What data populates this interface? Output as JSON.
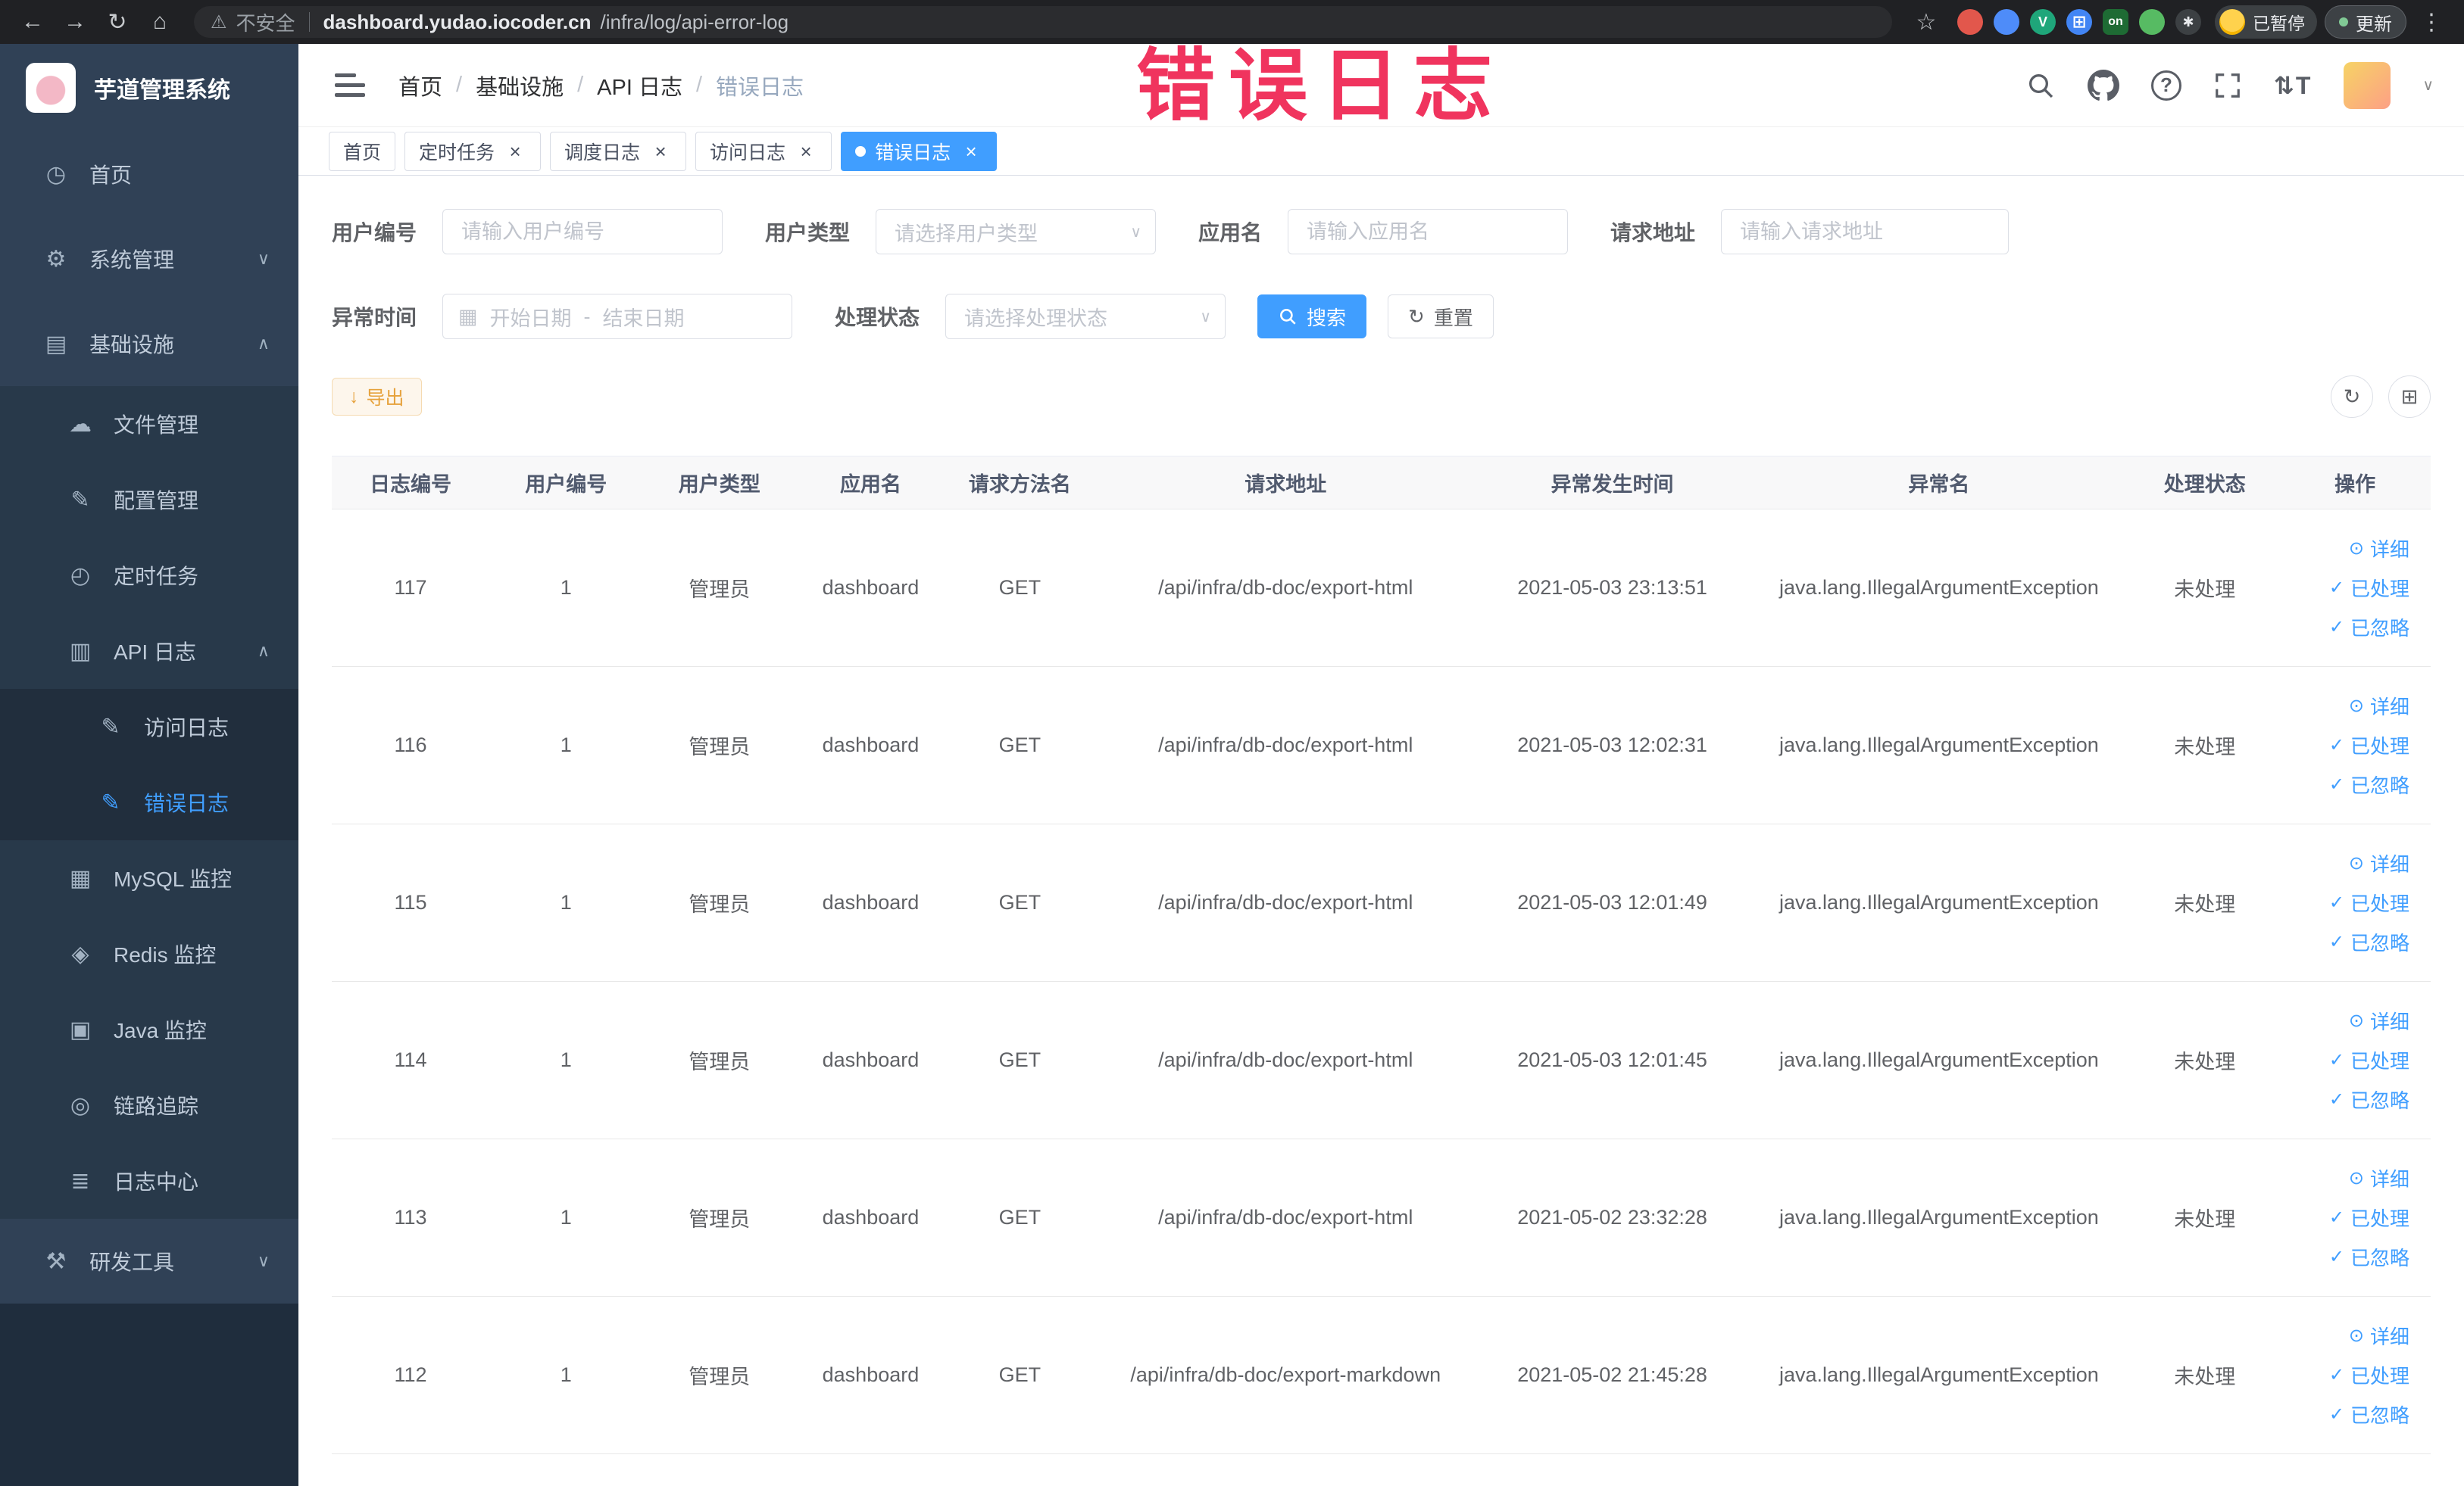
{
  "browser": {
    "security_label": "不安全",
    "url_domain": "dashboard.yudao.iocoder.cn",
    "url_path": "/infra/log/api-error-log",
    "on_badge": "on",
    "paused_badge": "已暂停",
    "update_button": "更新"
  },
  "watermark": "错误日志",
  "sidebar": {
    "logo_title": "芋道管理系统",
    "items": [
      {
        "key": "home",
        "label": "首页",
        "glyph": "◷",
        "icon": "dashboard",
        "level": 0
      },
      {
        "key": "system",
        "label": "系统管理",
        "glyph": "⚙",
        "icon": "gear",
        "level": 0,
        "arrow": "down"
      },
      {
        "key": "infrastructure",
        "label": "基础设施",
        "glyph": "▤",
        "icon": "infrastructure",
        "level": 0,
        "arrow": "up"
      },
      {
        "key": "file-manage",
        "label": "文件管理",
        "glyph": "☁",
        "icon": "file",
        "level": 1
      },
      {
        "key": "config-manage",
        "label": "配置管理",
        "glyph": "✎",
        "icon": "config",
        "level": 1
      },
      {
        "key": "scheduled-job",
        "label": "定时任务",
        "glyph": "◴",
        "icon": "timer",
        "level": 1
      },
      {
        "key": "api-log",
        "label": "API 日志",
        "glyph": "▥",
        "icon": "api-log",
        "level": 1,
        "arrow": "up"
      },
      {
        "key": "access-log",
        "label": "访问日志",
        "glyph": "✎",
        "icon": "access-log",
        "level": 2
      },
      {
        "key": "error-log",
        "label": "错误日志",
        "glyph": "✎",
        "icon": "error-log",
        "level": 2,
        "active": true
      },
      {
        "key": "mysql-monitor",
        "label": "MySQL 监控",
        "glyph": "▦",
        "icon": "mysql-monitor",
        "level": 1
      },
      {
        "key": "redis-monitor",
        "label": "Redis 监控",
        "glyph": "◈",
        "icon": "redis-monitor",
        "level": 1
      },
      {
        "key": "java-monitor",
        "label": "Java 监控",
        "glyph": "▣",
        "icon": "java-monitor",
        "level": 1
      },
      {
        "key": "trace",
        "label": "链路追踪",
        "glyph": "◎",
        "icon": "trace",
        "level": 1
      },
      {
        "key": "log-center",
        "label": "日志中心",
        "glyph": "≣",
        "icon": "log-center",
        "level": 1
      },
      {
        "key": "dev-tools",
        "label": "研发工具",
        "glyph": "⚒",
        "icon": "dev-tools",
        "level": 0,
        "arrow": "down"
      }
    ]
  },
  "breadcrumb": [
    "首页",
    "基础设施",
    "API 日志",
    "错误日志"
  ],
  "tabs": [
    {
      "key": "home",
      "label": "首页",
      "closable": false,
      "active": false
    },
    {
      "key": "scheduled-job",
      "label": "定时任务",
      "closable": true,
      "active": false
    },
    {
      "key": "job-log",
      "label": "调度日志",
      "closable": true,
      "active": false
    },
    {
      "key": "access-log",
      "label": "访问日志",
      "closable": true,
      "active": false
    },
    {
      "key": "error-log",
      "label": "错误日志",
      "closable": true,
      "active": true
    }
  ],
  "filters": {
    "user_id_label": "用户编号",
    "user_id_placeholder": "请输入用户编号",
    "user_type_label": "用户类型",
    "user_type_placeholder": "请选择用户类型",
    "app_label": "应用名",
    "app_placeholder": "请输入应用名",
    "url_label": "请求地址",
    "url_placeholder": "请输入请求地址",
    "time_label": "异常时间",
    "time_start_placeholder": "开始日期",
    "time_separator": "-",
    "time_end_placeholder": "结束日期",
    "status_label": "处理状态",
    "status_placeholder": "请选择处理状态",
    "search_button": "搜索",
    "reset_button": "重置"
  },
  "toolbar": {
    "export_button": "导出"
  },
  "table": {
    "columns": [
      {
        "key": "id",
        "label": "日志编号"
      },
      {
        "key": "user_id",
        "label": "用户编号"
      },
      {
        "key": "user_type",
        "label": "用户类型"
      },
      {
        "key": "app",
        "label": "应用名"
      },
      {
        "key": "method",
        "label": "请求方法名"
      },
      {
        "key": "url",
        "label": "请求地址"
      },
      {
        "key": "time",
        "label": "异常发生时间"
      },
      {
        "key": "exception",
        "label": "异常名"
      },
      {
        "key": "status",
        "label": "处理状态"
      },
      {
        "key": "actions",
        "label": "操作"
      }
    ],
    "row_actions": [
      "详细",
      "已处理",
      "已忽略"
    ],
    "rows": [
      {
        "id": "117",
        "user_id": "1",
        "user_type": "管理员",
        "app": "dashboard",
        "method": "GET",
        "url": "/api/infra/db-doc/export-html",
        "time": "2021-05-03 23:13:51",
        "exception": "java.lang.IllegalArgumentException",
        "status": "未处理"
      },
      {
        "id": "116",
        "user_id": "1",
        "user_type": "管理员",
        "app": "dashboard",
        "method": "GET",
        "url": "/api/infra/db-doc/export-html",
        "time": "2021-05-03 12:02:31",
        "exception": "java.lang.IllegalArgumentException",
        "status": "未处理"
      },
      {
        "id": "115",
        "user_id": "1",
        "user_type": "管理员",
        "app": "dashboard",
        "method": "GET",
        "url": "/api/infra/db-doc/export-html",
        "time": "2021-05-03 12:01:49",
        "exception": "java.lang.IllegalArgumentException",
        "status": "未处理"
      },
      {
        "id": "114",
        "user_id": "1",
        "user_type": "管理员",
        "app": "dashboard",
        "method": "GET",
        "url": "/api/infra/db-doc/export-html",
        "time": "2021-05-03 12:01:45",
        "exception": "java.lang.IllegalArgumentException",
        "status": "未处理"
      },
      {
        "id": "113",
        "user_id": "1",
        "user_type": "管理员",
        "app": "dashboard",
        "method": "GET",
        "url": "/api/infra/db-doc/export-html",
        "time": "2021-05-02 23:32:28",
        "exception": "java.lang.IllegalArgumentException",
        "status": "未处理"
      },
      {
        "id": "112",
        "user_id": "1",
        "user_type": "管理员",
        "app": "dashboard",
        "method": "GET",
        "url": "/api/infra/db-doc/export-markdown",
        "time": "2021-05-02 21:45:28",
        "exception": "java.lang.IllegalArgumentException",
        "status": "未处理"
      }
    ]
  }
}
